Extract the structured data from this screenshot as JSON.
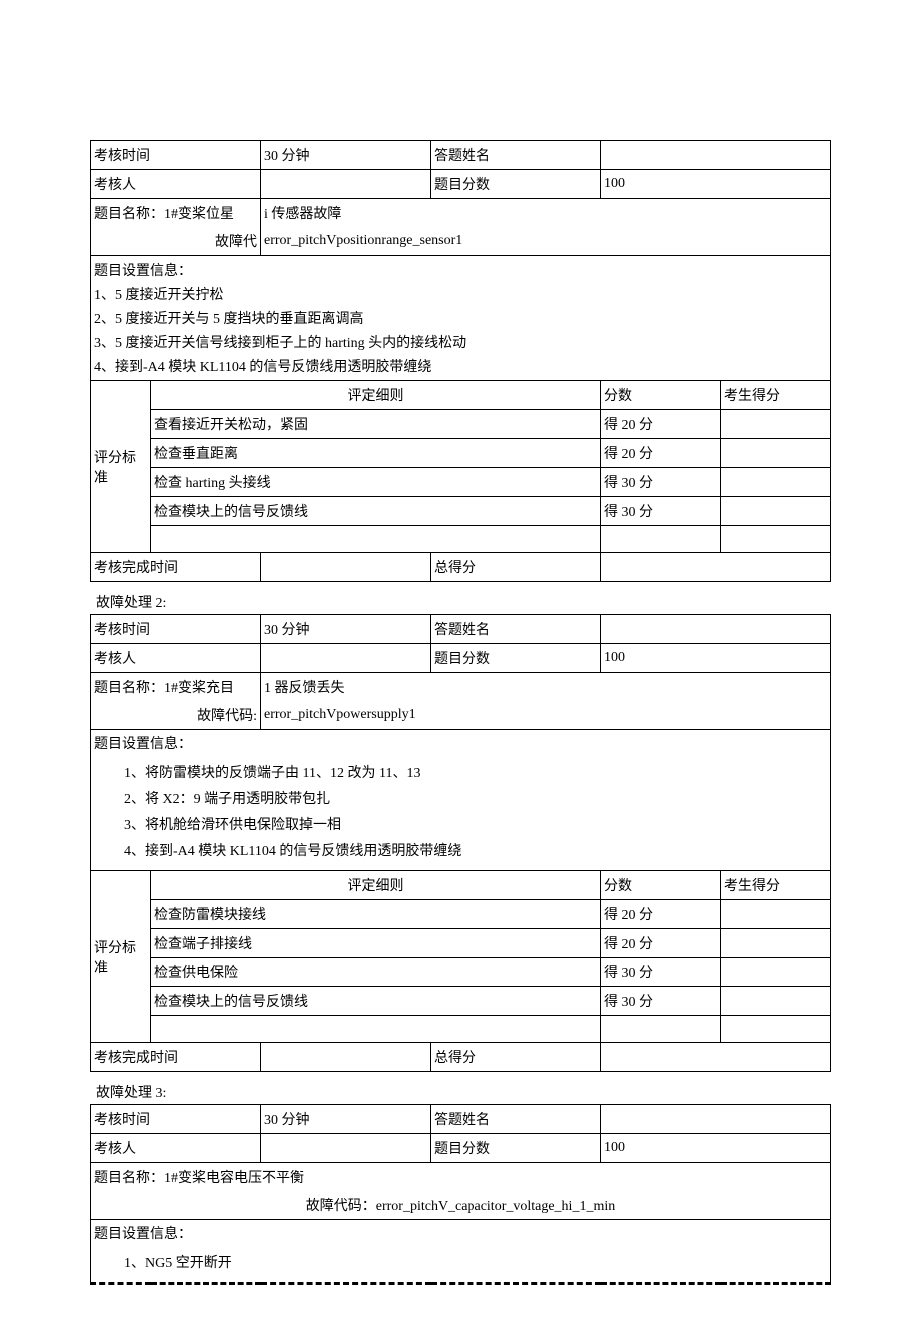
{
  "labels": {
    "exam_time": "考核时间",
    "examiner": "考核人",
    "answer_name": "答题姓名",
    "total_score_label": "题目分数",
    "topic_name": "题目名称：",
    "fault_code": "故障代",
    "fault_code_full": "故障代码:",
    "fault_code_cn": "故障代码：",
    "setup_info": "题目设置信息：",
    "criteria": "评定细则",
    "score": "分数",
    "student_score": "考生得分",
    "rating_std": "评分标准",
    "complete_time": "考核完成时间",
    "total": "总得分"
  },
  "task1": {
    "duration": "30 分钟",
    "full_score": "100",
    "title_prefix": "1#变桨位星",
    "title_suffix": "i 传感器故障",
    "fault_code": "error_pitchVpositionrange_sensor1",
    "setup": [
      "1、5 度接近开关拧松",
      "2、5 度接近开关与 5 度挡块的垂直距离调高",
      "3、5 度接近开关信号线接到柜子上的 harting 头内的接线松动",
      "4、接到-A4 模块 KL1104 的信号反馈线用透明胶带缠绕"
    ],
    "rows": [
      {
        "c": "查看接近开关松动，紧固",
        "s": "得 20 分"
      },
      {
        "c": "检查垂直距离",
        "s": "得 20 分"
      },
      {
        "c": "检查 harting 头接线",
        "s": "得 30 分"
      },
      {
        "c": "检查模块上的信号反馈线",
        "s": "得 30 分"
      }
    ]
  },
  "task2": {
    "section": "故障处理 2:",
    "duration": "30 分钟",
    "full_score": "100",
    "title_prefix": "1#变桨充目",
    "title_suffix": "1 器反馈丢失",
    "fault_code": "error_pitchVpowersupply1",
    "setup": [
      "1、将防雷模块的反馈端子由 11、12 改为 11、13",
      "2、将 X2：9 端子用透明胶带包扎",
      "3、将机舱给滑环供电保险取掉一相",
      "4、接到-A4 模块 KL1104 的信号反馈线用透明胶带缠绕"
    ],
    "rows": [
      {
        "c": "检查防雷模块接线",
        "s": "得 20 分"
      },
      {
        "c": "检查端子排接线",
        "s": "得 20 分"
      },
      {
        "c": "检查供电保险",
        "s": "得 30 分"
      },
      {
        "c": "检查模块上的信号反馈线",
        "s": "得 30 分"
      }
    ]
  },
  "task3": {
    "section": "故障处理 3:",
    "duration": "30 分钟",
    "full_score": "100",
    "title": "1#变桨电容电压不平衡",
    "fault_code": "error_pitchV_capacitor_voltage_hi_1_min",
    "setup": [
      "1、NG5 空开断开"
    ]
  }
}
